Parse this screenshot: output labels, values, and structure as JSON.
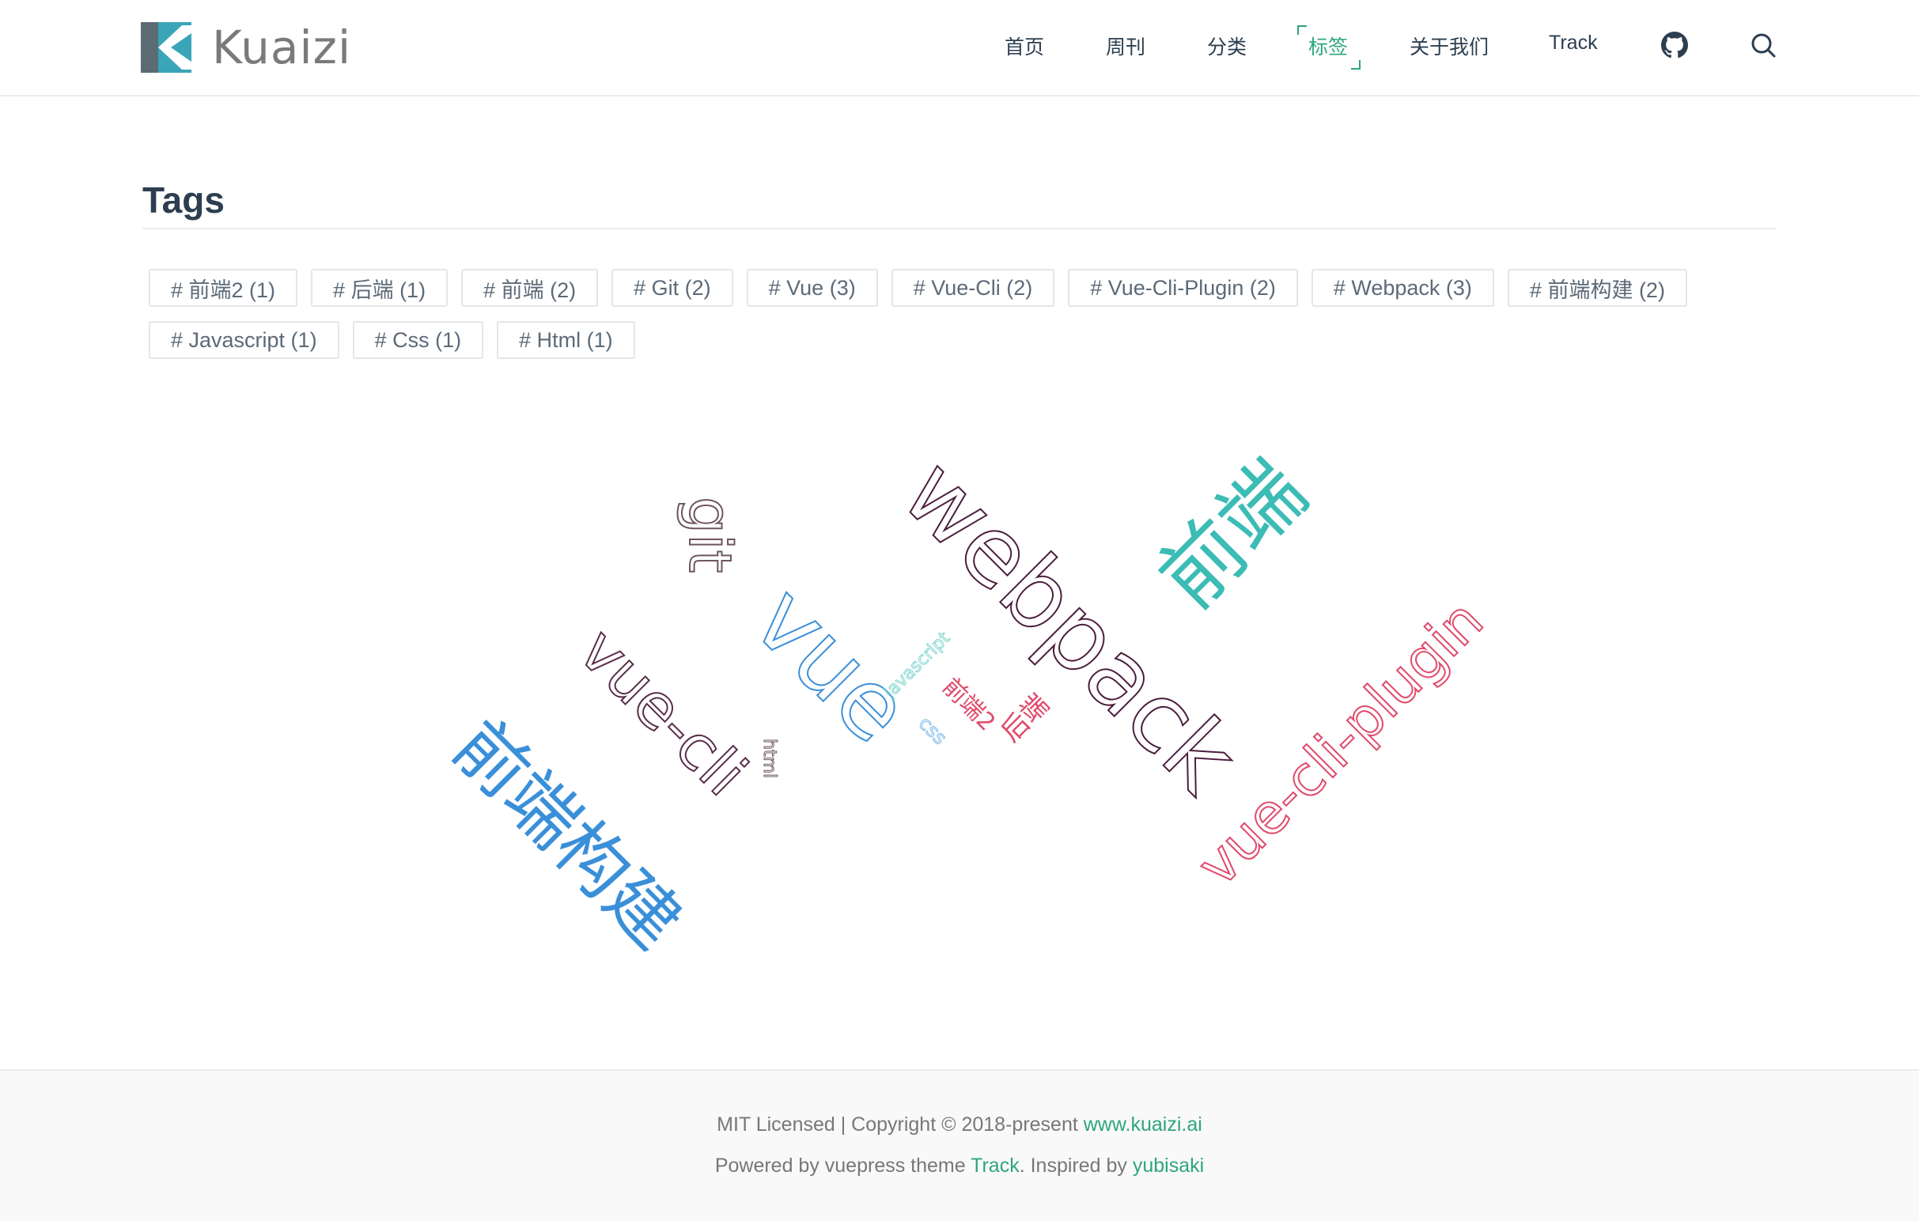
{
  "brand": {
    "name": "Kuaizi"
  },
  "nav": {
    "items": [
      {
        "label": "首页"
      },
      {
        "label": "周刊"
      },
      {
        "label": "分类"
      },
      {
        "label": "标签",
        "active": true
      },
      {
        "label": "关于我们"
      },
      {
        "label": "Track"
      }
    ],
    "icons": [
      "github-icon",
      "search-icon"
    ]
  },
  "page": {
    "title": "Tags"
  },
  "tags": [
    "# 前端2 (1)",
    "# 后端 (1)",
    "# 前端 (2)",
    "# Git (2)",
    "# Vue (3)",
    "# Vue-Cli (2)",
    "# Vue-Cli-Plugin (2)",
    "# Webpack (3)",
    "# 前端构建 (2)",
    "# Javascript (1)",
    "# Css (1)",
    "# Html (1)"
  ],
  "word_cloud": {
    "words": [
      {
        "text": "webpack",
        "color": "#4a1c3c"
      },
      {
        "text": "前端",
        "color": "#3bbcb5"
      },
      {
        "text": "git",
        "color": "#6d5560"
      },
      {
        "text": "vue",
        "color": "#3a8fd9"
      },
      {
        "text": "vue-cli",
        "color": "#5a2e4a"
      },
      {
        "text": "vue-cli-plugin",
        "color": "#e04a6a"
      },
      {
        "text": "前端构建",
        "color": "#3a8fd9"
      },
      {
        "text": "javascript",
        "color": "#7fd6d0"
      },
      {
        "text": "前端2",
        "color": "#e04a6a"
      },
      {
        "text": "后端",
        "color": "#e04a6a"
      },
      {
        "text": "css",
        "color": "#7ab8e8"
      },
      {
        "text": "html",
        "color": "#6d5560"
      }
    ]
  },
  "footer": {
    "license_text": "MIT Licensed | Copyright © 2018-present ",
    "license_link": "www.kuaizi.ai",
    "powered_text": "Powered by vuepress theme ",
    "theme_link": "Track",
    "inspired_text": ". Inspired by ",
    "inspired_link": "yubisaki"
  },
  "colors": {
    "accent": "#2ea67b",
    "text": "#2c3e50",
    "logo_mark": "#3aa5b8"
  }
}
